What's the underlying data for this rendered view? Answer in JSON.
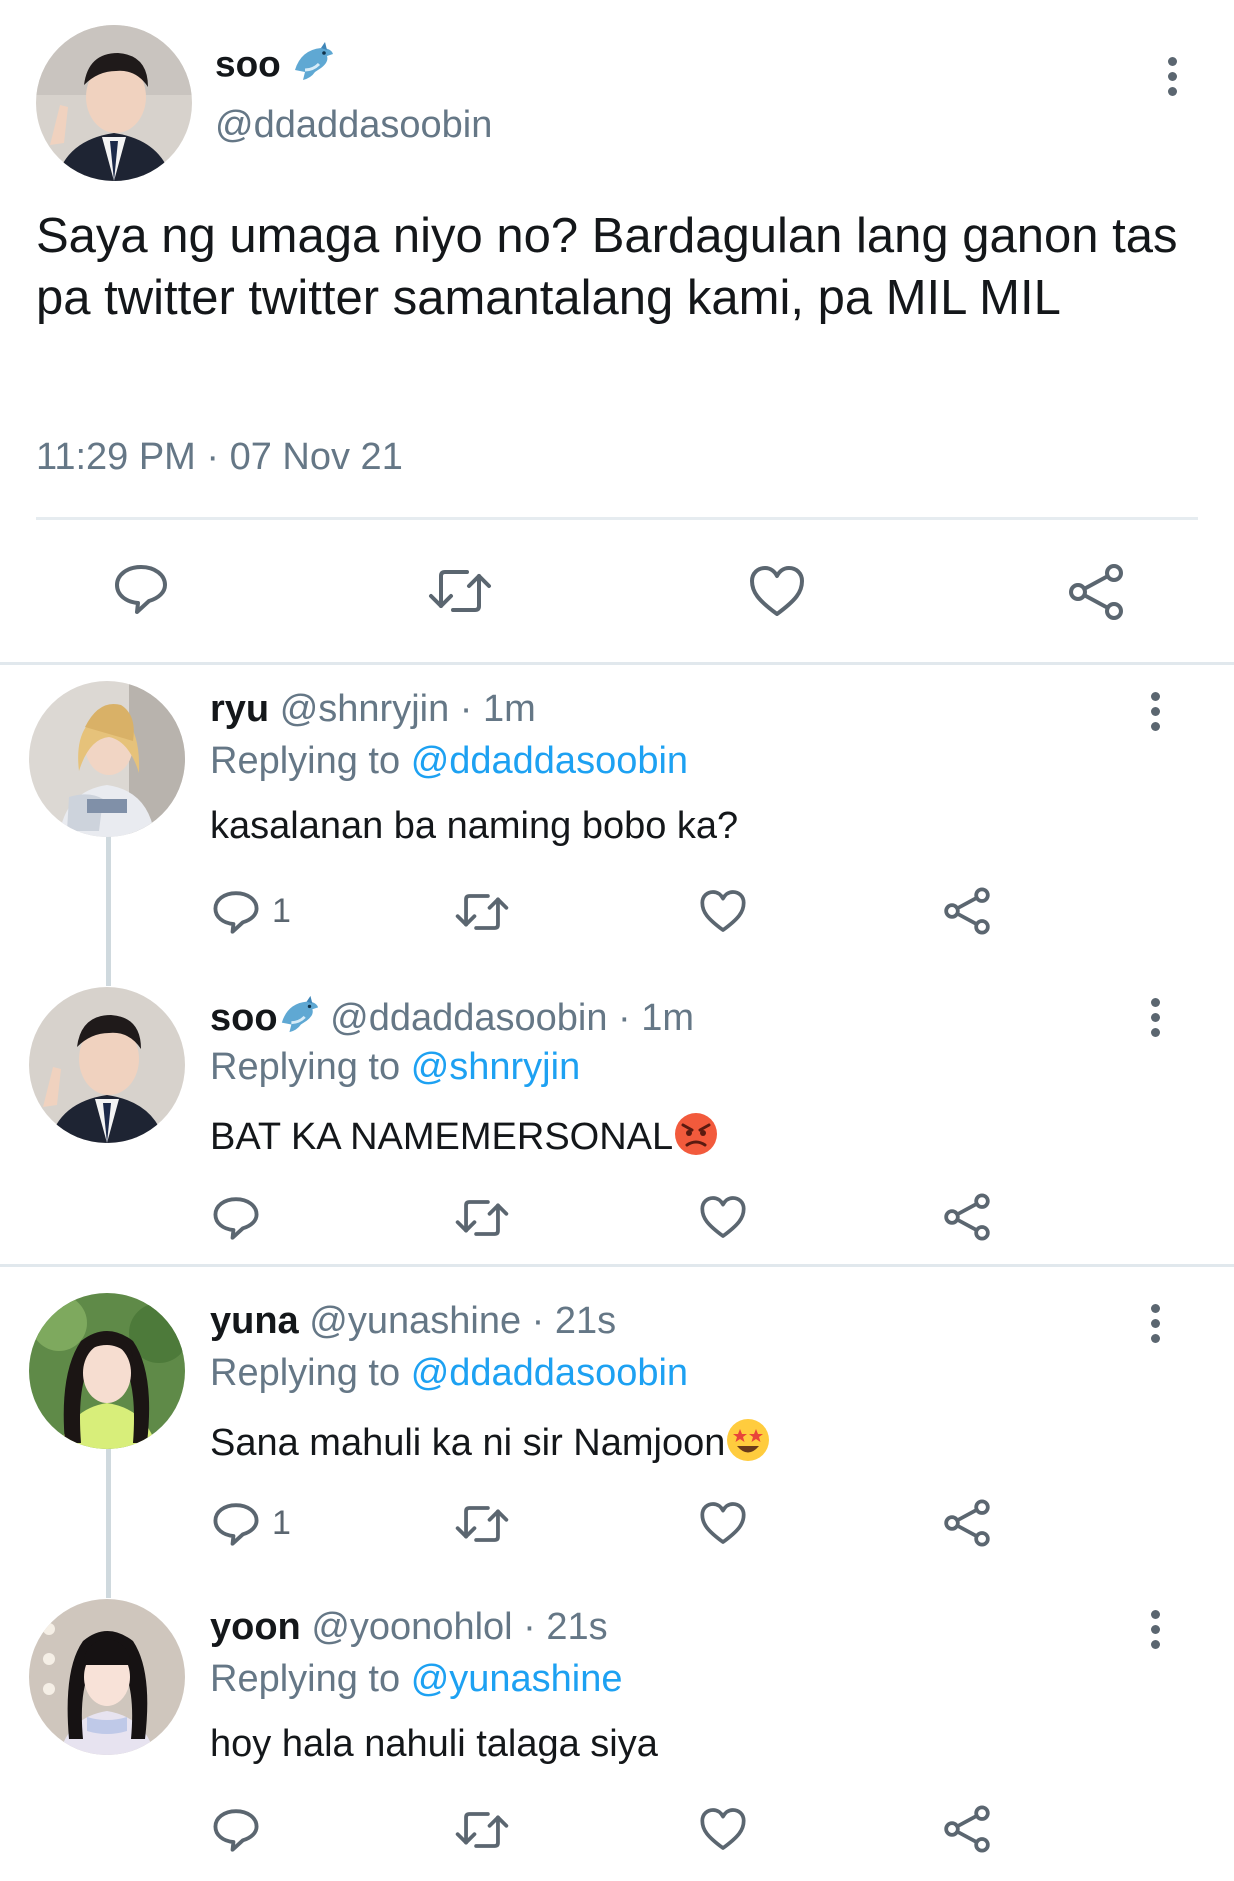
{
  "main_tweet": {
    "display_name": "soo",
    "name_emoji": "dolphin-icon",
    "handle": "@ddaddasoobin",
    "text": "Saya ng umaga niyo no? Bardagulan lang ganon tas pa twitter twitter samantalang kami, pa MIL MIL",
    "timestamp": "11:29 PM · 07 Nov 21",
    "actions": [
      "reply-icon",
      "retweet-icon",
      "like-icon",
      "share-icon"
    ]
  },
  "replies": [
    {
      "display_name": "ryu",
      "handle": "@shnryjin",
      "time": "· 1m",
      "replying_prefix": "Replying to",
      "replying_to": "@ddaddasoobin",
      "text": "kasalanan ba naming bobo ka?",
      "reply_count": "1"
    },
    {
      "display_name": "soo",
      "name_emoji": "dolphin-icon",
      "handle": "@ddaddasoobin",
      "time": "· 1m",
      "replying_prefix": "Replying to",
      "replying_to": "@shnryjin",
      "text": "BAT KA NAMEMERSONAL",
      "text_emoji": "angry-face-icon",
      "reply_count": ""
    },
    {
      "display_name": "yuna",
      "handle": "@yunashine",
      "time": "· 21s",
      "replying_prefix": "Replying to",
      "replying_to": "@ddaddasoobin",
      "text": "Sana mahuli ka ni sir Namjoon",
      "text_emoji": "star-struck-icon",
      "reply_count": "1"
    },
    {
      "display_name": "yoon",
      "handle": "@yoonohlol",
      "time": "· 21s",
      "replying_prefix": "Replying to",
      "replying_to": "@yunashine",
      "text": "hoy hala nahuli talaga siya",
      "reply_count": ""
    }
  ],
  "colors": {
    "link": "#1da1f2",
    "muted": "#657786",
    "icon": "#5b6670",
    "divider": "#e1e8ed"
  }
}
